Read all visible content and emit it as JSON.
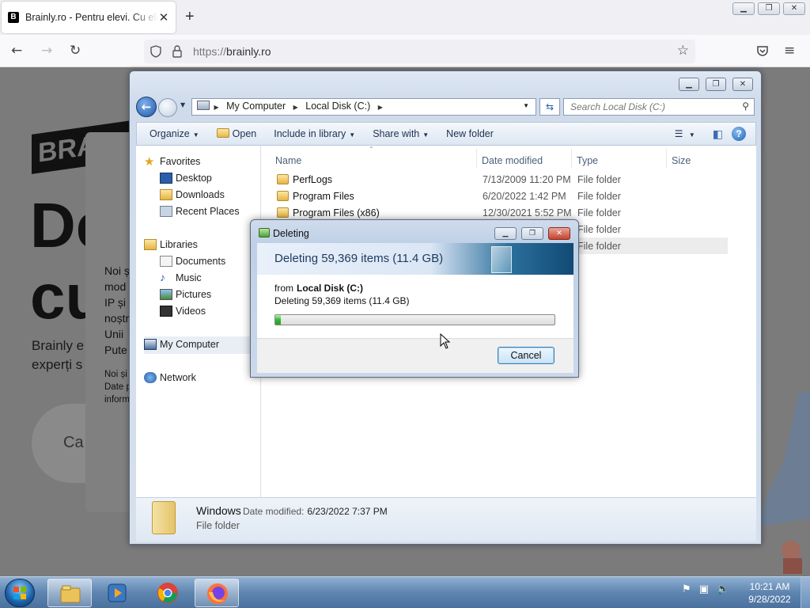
{
  "browser": {
    "tab_title": "Brainly.ro - Pentru elevi. Cu elevii",
    "tab_close": "✕",
    "new_tab": "+",
    "url_prefix": "https://",
    "url_domain": "brainly.ro"
  },
  "webpage": {
    "logo_text": "BRA",
    "headline_1": "De",
    "headline_2": "cu",
    "tagline_1": "Brainly e",
    "tagline_2": "experți s",
    "cta_label": "Ca",
    "cookie_lines": [
      "Noi ș",
      "mod",
      "IP și",
      "noștr",
      "Unii",
      "Pute"
    ],
    "cookie_small_lines": [
      "Noi și",
      "Date p",
      "inform"
    ]
  },
  "explorer": {
    "address": {
      "root": "My Computer",
      "drive": "Local Disk (C:)"
    },
    "search_placeholder": "Search Local Disk (C:)",
    "toolbar": {
      "organize": "Organize",
      "open": "Open",
      "include_library": "Include in library",
      "share_with": "Share with",
      "new_folder": "New folder"
    },
    "nav": {
      "favorites": "Favorites",
      "desktop": "Desktop",
      "downloads": "Downloads",
      "recent_places": "Recent Places",
      "libraries": "Libraries",
      "documents": "Documents",
      "music": "Music",
      "pictures": "Pictures",
      "videos": "Videos",
      "my_computer": "My Computer",
      "network": "Network"
    },
    "columns": {
      "name": "Name",
      "date": "Date modified",
      "type": "Type",
      "size": "Size"
    },
    "rows": [
      {
        "name": "PerfLogs",
        "date": "7/13/2009 11:20 PM",
        "type": "File folder"
      },
      {
        "name": "Program Files",
        "date": "6/20/2022 1:42 PM",
        "type": "File folder"
      },
      {
        "name": "Program Files (x86)",
        "date": "12/30/2021 5:52 PM",
        "type": "File folder"
      },
      {
        "name": "",
        "date": "",
        "type": "File folder"
      },
      {
        "name": "",
        "date": "",
        "type": "File folder"
      }
    ],
    "details": {
      "name": "Windows",
      "date_label": "Date modified:",
      "date_value": "6/23/2022 7:37 PM",
      "type": "File folder"
    }
  },
  "dialog": {
    "title": "Deleting",
    "heading": "Deleting 59,369 items (11.4 GB)",
    "from_label": "from",
    "from_location": "Local Disk (C:)",
    "subtext": "Deleting 59,369 items (11.4 GB)",
    "progress": 0.02,
    "cancel_label": "Cancel"
  },
  "taskbar": {
    "time": "10:21 AM",
    "date": "9/28/2022"
  }
}
